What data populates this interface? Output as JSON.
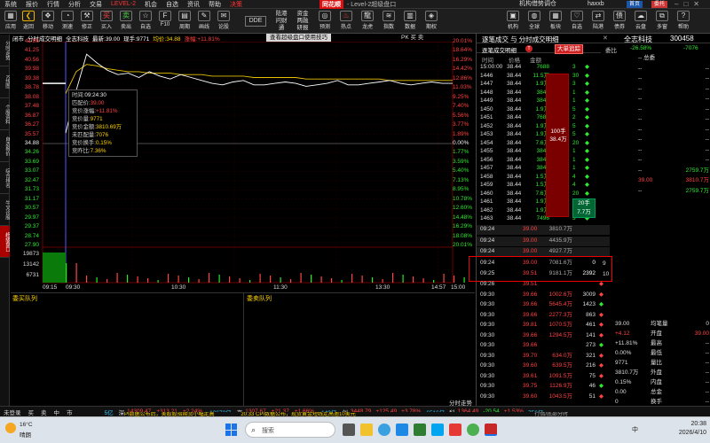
{
  "menubar": {
    "items": [
      "系统",
      "报价",
      "行情",
      "分析",
      "交易",
      "LEVEL-2",
      "机会",
      "自选",
      "资讯",
      "帮助",
      "决策"
    ],
    "logo": "同花顺",
    "title": "- Level-2超级盘口",
    "right_items": [
      "机构借势调仓",
      "haxxb",
      "首页",
      "委托"
    ]
  },
  "toolbar": {
    "left": [
      "应用",
      "返回",
      "移动",
      "测速",
      "修正",
      "买入",
      "卖出",
      "自选",
      "F10",
      "周期",
      "画线",
      "论股"
    ],
    "middle": [
      "DDE",
      "陆港",
      "资金",
      "问财",
      "通",
      "两融",
      "研报",
      "预测",
      "热点",
      "龙虎",
      "指数",
      "数据",
      "期权"
    ],
    "right": [
      "机构",
      "全球",
      "板块",
      "自选",
      "陆港",
      "债券",
      "云盘",
      "多窗",
      "帮助"
    ]
  },
  "sidebar": [
    "分时走势",
    "K线图",
    "个股资料",
    "自选报价",
    "综合排名",
    "牛叉诊股",
    "超级盘口"
  ],
  "chart": {
    "header": {
      "tab": "闭市",
      "name": "分时成交明细",
      "stock": "全志科技",
      "latest_label": "最新:",
      "latest": "39.00",
      "volume_label": "现手:",
      "volume": "9771",
      "avg_label": "均价:",
      "avg": "34.88",
      "change_label": "涨幅:",
      "change": "+11.81%"
    },
    "banner": "查看超级盘口使用技巧",
    "pk": "PK 买 卖",
    "left_axis": [
      "41.86",
      "41.25",
      "40.56",
      "39.98",
      "39.38",
      "38.78",
      "38.08",
      "37.48",
      "36.87",
      "36.27",
      "35.57",
      "34.88",
      "34.26",
      "33.69",
      "33.07",
      "32.47",
      "31.73",
      "31.17",
      "30.57",
      "29.97",
      "29.37",
      "28.74",
      "27.90"
    ],
    "right_axis": [
      "20.01%",
      "18.64%",
      "16.29%",
      "14.42%",
      "12.86%",
      "11.03%",
      "9.25%",
      "7.40%",
      "5.56%",
      "3.77%",
      "1.89%",
      "0.00%",
      "1.77%",
      "3.59%",
      "5.40%",
      "7.13%",
      "8.95%",
      "10.78%",
      "12.60%",
      "14.48%",
      "16.29%",
      "18.08%",
      "20.01%"
    ],
    "vol_axis": [
      "19873",
      "13142",
      "6731"
    ],
    "time_labels": [
      "09:15",
      "09:30",
      "10:30",
      "11:30",
      "13:30",
      "14:57",
      "15:00"
    ],
    "prices": [
      35.6,
      38.5,
      41.0,
      40.4,
      39.9,
      39.6,
      39.7,
      39.4,
      39.8,
      39.5,
      39.3,
      39.6,
      39.4,
      39.2,
      39.0,
      38.9,
      39.1,
      39.2,
      38.9,
      38.9,
      39.0,
      39.1,
      39.0,
      38.8,
      38.9,
      39.0,
      39.2,
      38.9,
      38.9,
      39.0,
      39.1,
      39.2,
      39.0,
      38.9,
      39.0,
      39.1,
      39.0,
      39.0
    ],
    "avg_line": [
      38.3,
      39.8,
      40.3,
      40.2,
      40.0,
      39.9,
      39.8,
      39.8,
      39.7,
      39.7,
      39.7,
      39.6,
      39.6,
      39.6,
      39.5,
      39.5,
      39.5,
      39.5,
      39.4,
      39.4,
      39.4,
      39.4,
      39.4,
      39.3,
      39.3,
      39.3,
      39.3,
      39.3,
      39.3,
      39.3,
      39.3,
      39.2,
      39.2,
      39.2,
      39.2,
      39.2,
      39.2,
      39.2
    ]
  },
  "tooltip": {
    "time_label": "时间:",
    "time": "09:24:30",
    "price_label": "匹配价:",
    "price": "39.00",
    "chg_label": "竞价涨幅:",
    "chg": "+11.81%",
    "amt_label": "竞价量:",
    "amt": "9771",
    "money_label": "竞价金额:",
    "money": "3810.69万",
    "unm_label": "未匹配量:",
    "unm": "7076",
    "turn_label": "竞价换手:",
    "turn": "0.15%",
    "ratio_label": "竞昨比:",
    "ratio": "7.36%"
  },
  "queue": {
    "buy_title": "委买队列",
    "sell_title": "委卖队列"
  },
  "right_panel": {
    "title": "逐笔成交 与 分时成交明细",
    "stock_name": "全志科技",
    "code": "300458",
    "tab1": "逐笔成交明细",
    "tab2": "大单追踪",
    "toggle": "T",
    "weibi": "委比",
    "weibi_val": "-26.58%",
    "weicha_val": "-7076",
    "col_headers": [
      "时间",
      "价格",
      "金额"
    ],
    "ticks": [
      {
        "t": "15:00:00",
        "p": "38.44",
        "a": "7688"
      },
      {
        "t": "1446",
        "p": "38.44",
        "a": "11.5万"
      },
      {
        "t": "1447",
        "p": "38.44",
        "a": "1.9万"
      },
      {
        "t": "1448",
        "p": "38.44",
        "a": "3844"
      },
      {
        "t": "1449",
        "p": "38.44",
        "a": "3844"
      },
      {
        "t": "1450",
        "p": "38.44",
        "a": "1.9万"
      },
      {
        "t": "1451",
        "p": "38.44",
        "a": "7688"
      },
      {
        "t": "1452",
        "p": "38.44",
        "a": "1.9万"
      },
      {
        "t": "1453",
        "p": "38.44",
        "a": "1.9万"
      },
      {
        "t": "1454",
        "p": "38.44",
        "a": "7.6万"
      },
      {
        "t": "1455",
        "p": "38.44",
        "a": "3844"
      },
      {
        "t": "1456",
        "p": "38.44",
        "a": "3844"
      },
      {
        "t": "1457",
        "p": "38.44",
        "a": "3844"
      },
      {
        "t": "1458",
        "p": "38.44",
        "a": "1.5万"
      },
      {
        "t": "1459",
        "p": "38.44",
        "a": "1.5万"
      },
      {
        "t": "1460",
        "p": "38.44",
        "a": "7.6万"
      },
      {
        "t": "1461",
        "p": "38.44",
        "a": "1.9万"
      },
      {
        "t": "1462",
        "p": "38.44",
        "a": "1.9万"
      },
      {
        "t": "1463",
        "p": "38.44",
        "a": "7496"
      }
    ],
    "big_order": "100手\n38.4万",
    "side_counts": [
      "3",
      "30",
      "3",
      "1",
      "1",
      "5",
      "2",
      "5",
      "5",
      "20",
      "1",
      "1",
      "1",
      "4",
      "4",
      "20",
      "3",
      "3",
      "3"
    ],
    "right_side": {
      "line1": "20手",
      "line2": "7.7万"
    },
    "ws_header": "-- 总委",
    "big_col_label1": "--",
    "mid_rows": [
      {
        "t": "09:24",
        "p": "39.00",
        "a": "3810.7万",
        "n": ""
      },
      {
        "t": "09:24",
        "p": "39.00",
        "a": "4435.9万",
        "n": ""
      },
      {
        "t": "09:24",
        "p": "39.00",
        "a": "4927.7万",
        "n": ""
      },
      {
        "t": "09:24",
        "p": "39.00",
        "a": "7081.6万",
        "n": "0"
      },
      {
        "t": "09:25",
        "p": "39.51",
        "a": "9181.1万",
        "n": "2392"
      }
    ],
    "lower_rows": [
      {
        "t": "09:26",
        "p": "39.51",
        "a": "",
        "n": ""
      },
      {
        "t": "09:30",
        "p": "39.66",
        "a": "1002.6万",
        "n": "3009"
      },
      {
        "t": "09:30",
        "p": "39.66",
        "a": "5645.4万",
        "n": "1423"
      },
      {
        "t": "09:30",
        "p": "39.66",
        "a": "2277.3万",
        "n": "863"
      },
      {
        "t": "09:30",
        "p": "39.81",
        "a": "1070.5万",
        "n": "461"
      },
      {
        "t": "09:30",
        "p": "39.66",
        "a": "1294.5万",
        "n": "141"
      },
      {
        "t": "09:30",
        "p": "39.66",
        "a": "",
        "n": "273"
      },
      {
        "t": "09:30",
        "p": "39.70",
        "a": "634.0万",
        "n": "321"
      },
      {
        "t": "09:30",
        "p": "39.60",
        "a": "639.5万",
        "n": "216"
      },
      {
        "t": "09:30",
        "p": "39.61",
        "a": "1091.5万",
        "n": "75"
      },
      {
        "t": "09:30",
        "p": "39.75",
        "a": "1126.9万",
        "n": "46"
      },
      {
        "t": "09:30",
        "p": "39.60",
        "a": "1043.5万",
        "n": "51"
      }
    ],
    "rank": [
      "1",
      "2",
      "3",
      "4",
      "5",
      "6",
      "7",
      "8",
      "9",
      "10"
    ],
    "quote_labels": [
      "委差",
      "卖⑤",
      "卖④",
      "卖③",
      "卖②",
      "卖①",
      "买①",
      "买②",
      "买③",
      "买④",
      "买⑤",
      "均笔量",
      "最新",
      "涨跌",
      "涨幅",
      "振幅",
      "总手",
      "金额",
      "换手",
      "量比",
      "外盘",
      "内盘",
      "净资",
      "跌停"
    ],
    "quote_values": [
      "-7076",
      "--",
      "--",
      "--",
      "--",
      "39.00",
      "--",
      "--",
      "--",
      "--",
      "--",
      "0",
      "39.00",
      "+4.12",
      "+11.81%",
      "0.00%",
      "9771",
      "3810.7万",
      "0.15%",
      "0.00",
      "0",
      "9771",
      "--",
      "--"
    ],
    "bid_price": "39.00",
    "bid_vol": "3810.7万",
    "ask_vol": "2759.7万",
    "mid_labels": [
      "均笔量",
      "开盘",
      "最高",
      "最低",
      "量比",
      "外盘",
      "内盘",
      "总金",
      "换手",
      "跌停"
    ],
    "mid_vals": [
      "0",
      "39.00",
      "--",
      "--",
      "--",
      "--",
      "--",
      "--",
      "--",
      "--"
    ]
  },
  "status": {
    "login": "未登录",
    "buy": "买",
    "sell": "卖",
    "mid": "中",
    "market": "市",
    "index1_label": "沪",
    "index1": "5亿",
    "index2_label": "深",
    "index2": "14309.47",
    "index2_chg": "+313.21",
    "index2_pct": "+2.24%",
    "index3": "13672亿",
    "index4_label": "京",
    "index4": "1307.67",
    "index4_chg": "+21.37",
    "index4_pct": "+1.66%",
    "index5": "149亿",
    "index6_label": "创",
    "index6": "3448.79",
    "index6_chg": "+125.49",
    "index6_pct": "+3.78%",
    "index7": "6516亿",
    "index8_label": "科",
    "index8": "1364.49",
    "index8_chg": "-20.54",
    "index8_pct": "+1.53%",
    "index9": "756亿",
    "news1": "PI数据公布后，美股股指期货小幅走高",
    "news2": "20:33 CPI数据公布，现货黄金短线走高逾10美元",
    "news3": "行情/底部分时",
    "ticker_label": "分时走势"
  },
  "taskbar": {
    "weather_temp": "16°C",
    "weather_desc": "晴朗",
    "search": "搜索",
    "ime": "中",
    "time": "20:38",
    "date": "2026/4/10"
  }
}
